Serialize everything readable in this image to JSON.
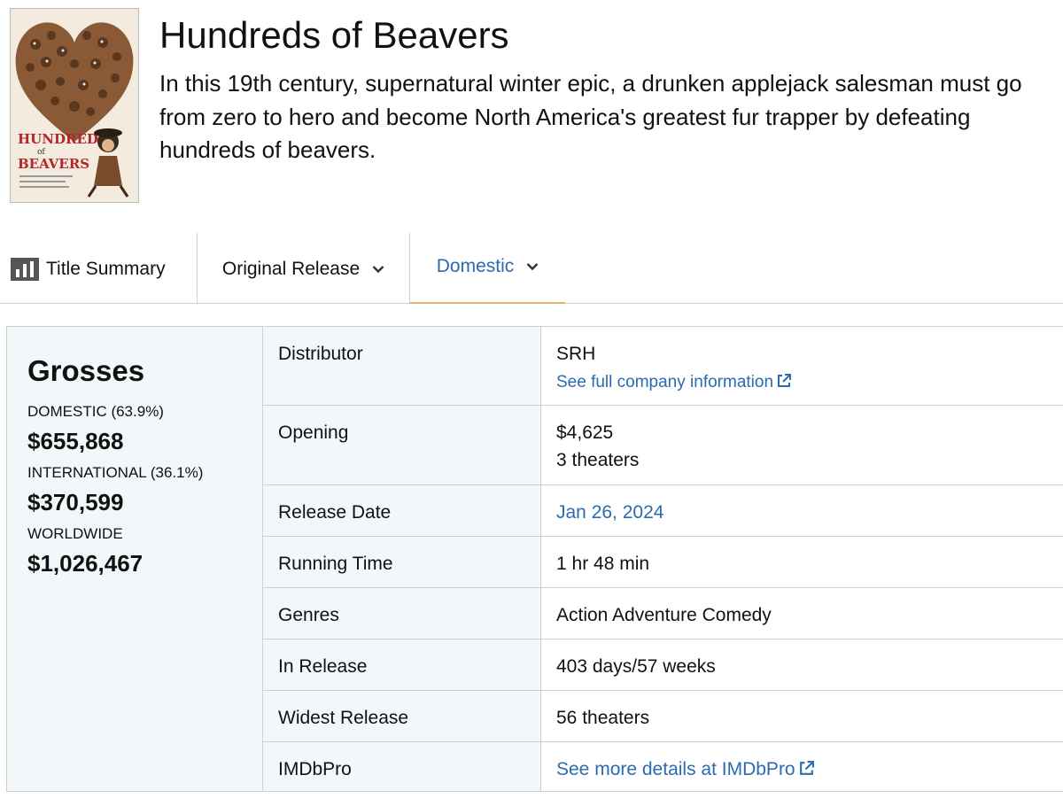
{
  "movie": {
    "title": "Hundreds of Beavers",
    "synopsis": "In this 19th century, supernatural winter epic, a drunken applejack salesman must go from zero to hero and become North America's greatest fur trapper by defeating hundreds of beavers.",
    "poster": {
      "headline_top": "HUNDREDS",
      "headline_mid": "of",
      "headline_bottom": "BEAVERS"
    }
  },
  "tabs": [
    {
      "label": "Title Summary",
      "icon": "bar-chart-icon",
      "active": false
    },
    {
      "label": "Original Release",
      "icon": "chevron-down-icon",
      "active": false
    },
    {
      "label": "Domestic",
      "icon": "chevron-down-icon",
      "active": true
    }
  ],
  "grosses": {
    "title": "Grosses",
    "domestic_label": "DOMESTIC (63.9%)",
    "domestic_value": "$655,868",
    "international_label": "INTERNATIONAL (36.1%)",
    "international_value": "$370,599",
    "worldwide_label": "WORLDWIDE",
    "worldwide_value": "$1,026,467"
  },
  "details": {
    "distributor": {
      "label": "Distributor",
      "value": "SRH",
      "link": "See full company information"
    },
    "opening": {
      "label": "Opening",
      "value": "$4,625",
      "theaters": "3 theaters"
    },
    "release_date": {
      "label": "Release Date",
      "value": "Jan 26, 2024"
    },
    "running_time": {
      "label": "Running Time",
      "value": "1 hr 48 min"
    },
    "genres": {
      "label": "Genres",
      "value": "Action Adventure Comedy"
    },
    "in_release": {
      "label": "In Release",
      "value": "403 days/57 weeks"
    },
    "widest_release": {
      "label": "Widest Release",
      "value": "56 theaters"
    },
    "imdbpro": {
      "label": "IMDbPro",
      "link": "See more details at IMDbPro"
    }
  },
  "colors": {
    "link": "#2a6bb1",
    "active_tab_underline": "#e3b26e",
    "panel_bg": "#f2f7f9",
    "border": "#cfcfcf"
  }
}
